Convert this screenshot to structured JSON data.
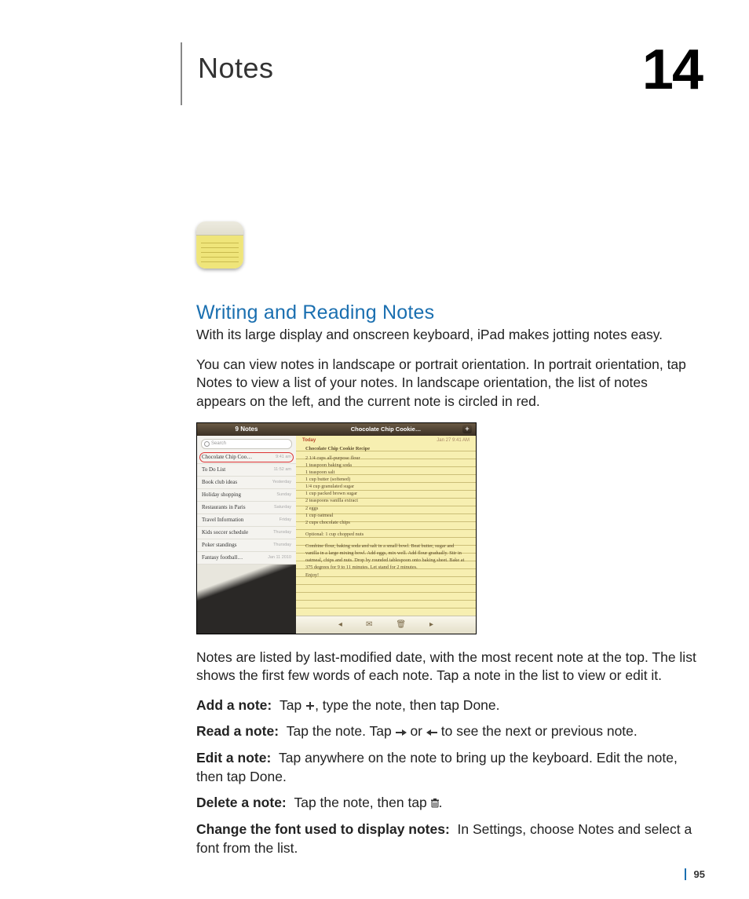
{
  "chapter": {
    "title": "Notes",
    "number": "14"
  },
  "section_heading": "Writing and Reading Notes",
  "intro1": "With its large display and onscreen keyboard, iPad makes jotting notes easy.",
  "intro2": "You can view notes in landscape or portrait orientation. In portrait orientation, tap Notes to view a list of your notes. In landscape orientation, the list of notes appears on the left, and the current note is circled in red.",
  "after_shot": "Notes are listed by last-modified date, with the most recent note at the top. The list shows the first few words of each note. Tap a note in the list to view or edit it.",
  "instructions": {
    "add": {
      "label": "Add a note:",
      "pre": "Tap ",
      "post": ", type the note, then tap Done."
    },
    "read": {
      "label": "Read a note:",
      "pre": "Tap the note. Tap ",
      "mid": " or ",
      "post": " to see the next or previous note."
    },
    "edit": {
      "label": "Edit a note:",
      "text": "Tap anywhere on the note to bring up the keyboard. Edit the note, then tap Done."
    },
    "del": {
      "label": "Delete a note:",
      "pre": "Tap the note, then tap ",
      "post": "."
    },
    "font": {
      "label": "Change the font used to display notes:",
      "text": "In Settings, choose Notes and select a font from the list."
    }
  },
  "screenshot": {
    "list_header": "9 Notes",
    "search_placeholder": "Search",
    "rows": [
      {
        "t": "Chocolate Chip Coo…",
        "d": "9:41 am",
        "sel": true
      },
      {
        "t": "To Do List",
        "d": "11:52 am"
      },
      {
        "t": "Book club ideas",
        "d": "Yesterday"
      },
      {
        "t": "Holiday shopping",
        "d": "Sunday"
      },
      {
        "t": "Restaurants in Paris",
        "d": "Saturday"
      },
      {
        "t": "Travel Information",
        "d": "Friday"
      },
      {
        "t": "Kids soccer schedule",
        "d": "Thursday"
      },
      {
        "t": "Poker standings",
        "d": "Thursday"
      },
      {
        "t": "Fantasy football…",
        "d": "Jan 11 2010"
      }
    ],
    "note_header": "Chocolate Chip Cookie…",
    "today": "Today",
    "datetime": "Jan 27   9:41 AM",
    "note_title": "Chocolate Chip Cookie Recipe",
    "ingredients": [
      "2 1/4 cups all-purpose flour",
      "1 teaspoon baking soda",
      "1 teaspoon salt",
      "1 cup butter (softened)",
      "1/4 cup granulated sugar",
      "1 cup packed brown sugar",
      "2 teaspoons vanilla extract",
      "2 eggs",
      "1 cup oatmeal",
      "2 cups chocolate chips"
    ],
    "optional": "Optional: 1 cup chopped nuts",
    "directions": "Combine flour, baking soda and salt in a small bowl. Beat butter, sugar and vanilla in a large mixing bowl. Add eggs, mix well. Add flour gradually. Stir in oatmeal, chips and nuts. Drop by rounded tablespoon onto baking sheet. Bake at 375 degrees for 9 to 11 minutes. Let stand for 2 minutes.",
    "enjoy": "Enjoy!"
  },
  "page_number": "95"
}
